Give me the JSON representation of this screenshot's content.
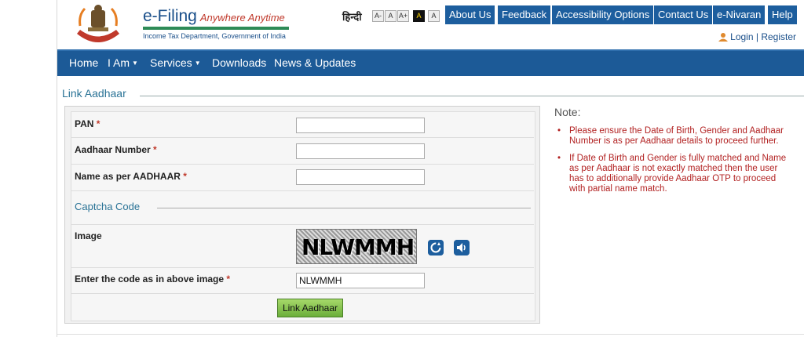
{
  "header": {
    "brand": "e-Filing",
    "tagline": "Anywhere Anytime",
    "subtitle": "Income Tax Department, Government of India",
    "hindi_link": "हिन्दी",
    "font_sizes": [
      "A-",
      "A",
      "A+",
      "A",
      "A"
    ],
    "top_links": [
      "About Us",
      "Feedback",
      "Accessibility Options",
      "Contact Us",
      "e-Nivaran",
      "Help"
    ],
    "login": "Login",
    "register": "Register"
  },
  "menu": {
    "items": [
      {
        "label": "Home",
        "dropdown": false
      },
      {
        "label": "I Am",
        "dropdown": true
      },
      {
        "label": "Services",
        "dropdown": true
      },
      {
        "label": "Downloads",
        "dropdown": false
      },
      {
        "label": "News & Updates",
        "dropdown": false
      }
    ]
  },
  "page": {
    "title": "Link Aadhaar"
  },
  "form": {
    "pan_label": "PAN",
    "aadhaar_label": "Aadhaar Number",
    "name_label": "Name as per AADHAAR",
    "required_mark": "*",
    "pan_value": "",
    "aadhaar_value": "",
    "name_value": "",
    "captcha_section": "Captcha Code",
    "image_label": "Image",
    "captcha_text": "NLWMMH",
    "code_label": "Enter the code as in above image",
    "code_value": "NLWMMH",
    "submit_label": "Link Aadhaar"
  },
  "note": {
    "title": "Note:",
    "items": [
      "Please ensure the Date of Birth, Gender and Aadhaar Number is as per Aadhaar details to proceed further.",
      "If Date of Birth and Gender is fully matched and Name as per Aadhaar is not exactly matched then the user has to additionally provide Aadhaar OTP to proceed with partial name match."
    ]
  },
  "colors": {
    "nav_blue": "#1d5e9e",
    "menu_blue": "#1c5a97",
    "note_red": "#b22222",
    "section_teal": "#2a7396",
    "button_green": "#6bae3a"
  }
}
